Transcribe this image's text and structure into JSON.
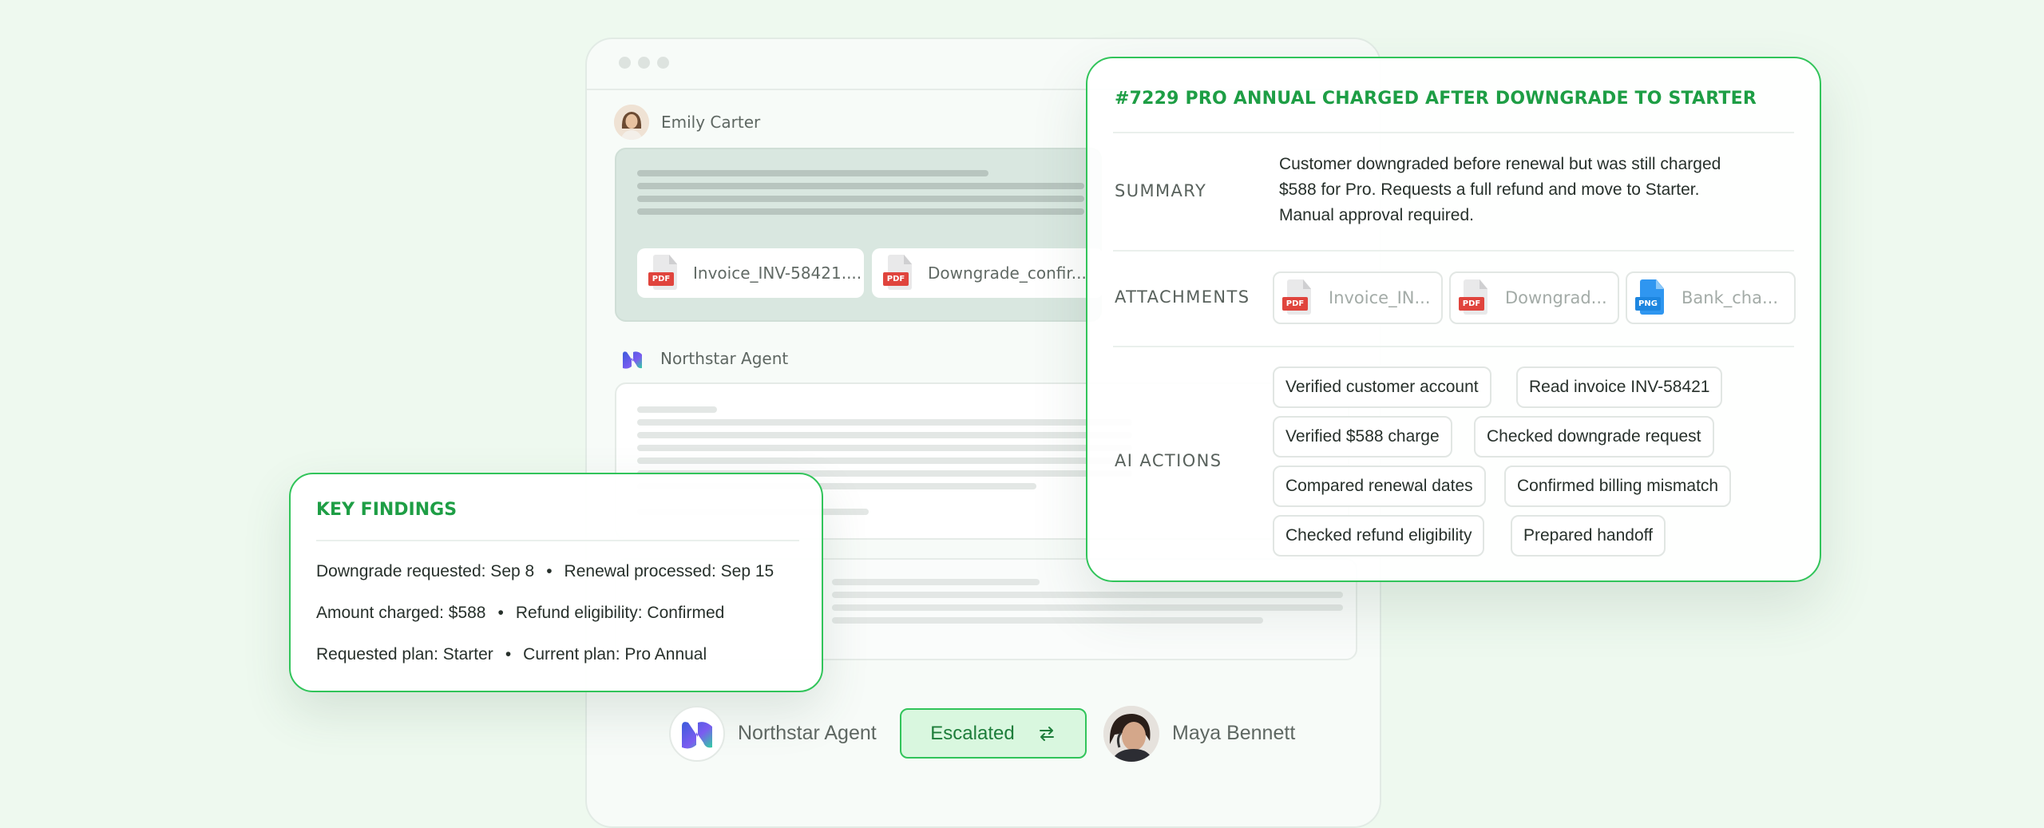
{
  "conversation": {
    "customer_name": "Emily Carter",
    "customer_attachments": [
      {
        "type": "PDF",
        "name": "Invoice_INV-58421...."
      },
      {
        "type": "PDF",
        "name": "Downgrade_confir..."
      }
    ],
    "agent_name": "Northstar Agent"
  },
  "ticket": {
    "title": "#7229 PRO ANNUAL CHARGED AFTER DOWNGRADE TO STARTER",
    "summary_label": "SUMMARY",
    "summary_lines": [
      "Customer downgraded before renewal but was still charged",
      "$588 for Pro. Requests a full refund and move to Starter.",
      "Manual approval required."
    ],
    "attachments_label": "ATTACHMENTS",
    "attachments": [
      {
        "type": "PDF",
        "name": "Invoice_IN..."
      },
      {
        "type": "PDF",
        "name": "Downgrad..."
      },
      {
        "type": "PNG",
        "name": "Bank_cha..."
      }
    ],
    "ai_actions_label": "AI ACTIONS",
    "ai_actions": [
      "Verified customer account",
      "Read invoice INV-58421",
      "Verified $588 charge",
      "Checked downgrade request",
      "Compared renewal dates",
      "Confirmed billing mismatch",
      "Checked refund eligibility",
      "Prepared handoff"
    ]
  },
  "key_findings": {
    "title": "KEY FINDINGS",
    "rows": [
      [
        "Downgrade requested: Sep 8",
        "Renewal processed: Sep 15"
      ],
      [
        "Amount charged: $588",
        "Refund eligibility: Confirmed"
      ],
      [
        "Requested plan: Starter",
        "Current plan: Pro Annual"
      ]
    ],
    "separator": "•"
  },
  "handoff": {
    "from_name": "Northstar Agent",
    "status_label": "Escalated",
    "status_icon": "swap-arrows-icon",
    "to_name": "Maya Bennett"
  },
  "colors": {
    "accent": "#1e9e45",
    "accent_border": "#31c45a",
    "background": "#eef9ef",
    "pdf_red": "#e0443d",
    "png_blue": "#1d86e0"
  }
}
